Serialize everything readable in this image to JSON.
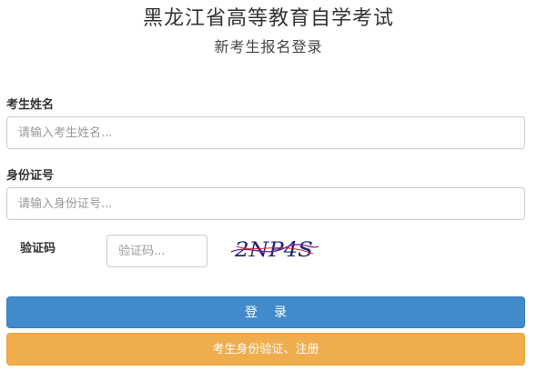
{
  "header": {
    "title": "黑龙江省高等教育自学考试",
    "subtitle": "新考生报名登录"
  },
  "form": {
    "name": {
      "label": "考生姓名",
      "placeholder": "请输入考生姓名..."
    },
    "id_number": {
      "label": "身份证号",
      "placeholder": "请输入身份证号..."
    },
    "captcha": {
      "label": "验证码",
      "placeholder": "验证码...",
      "image_text": "2NP4S"
    }
  },
  "buttons": {
    "login_label": "登录",
    "register_label": "考生身份验证、注册"
  },
  "colors": {
    "login_button": "#428bca",
    "register_button": "#f0ad4e",
    "captcha_text": "#1a237e"
  }
}
